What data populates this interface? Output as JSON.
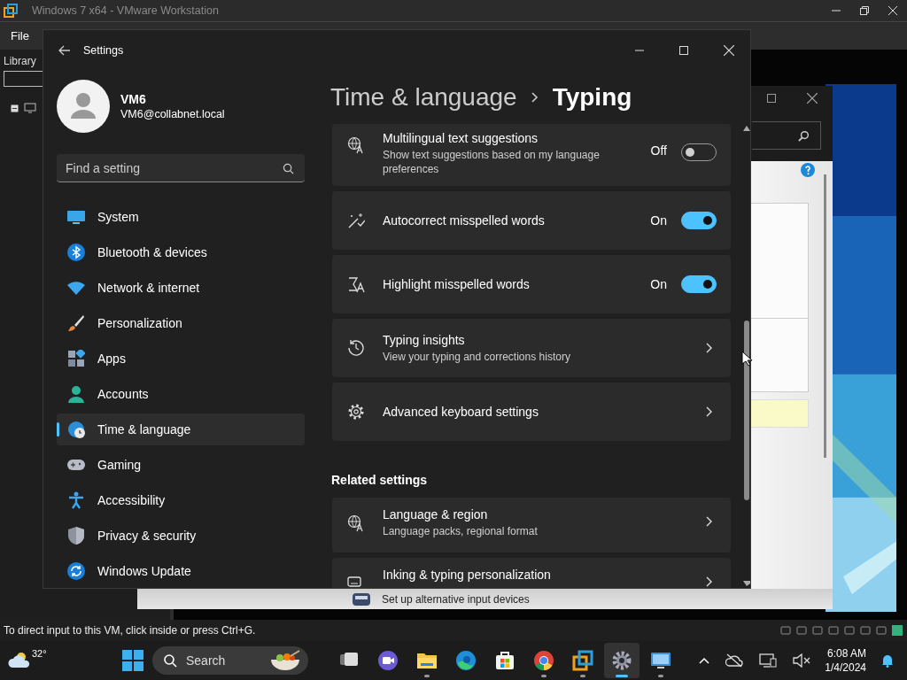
{
  "vmware": {
    "title": "Windows 7 x64 - VMware Workstation",
    "menu": [
      "File"
    ],
    "library_label": "Library",
    "status_text": "To direct input to this VM, click inside or press Ctrl+G."
  },
  "background_window": {
    "text": "Set up alternative input devices"
  },
  "settings": {
    "title": "Settings",
    "user": {
      "name": "VM6",
      "email": "VM6@collabnet.local"
    },
    "search": {
      "placeholder": "Find a setting"
    },
    "nav": [
      {
        "kind": "system",
        "label": "System",
        "selected": false
      },
      {
        "kind": "bluetooth",
        "label": "Bluetooth & devices",
        "selected": false
      },
      {
        "kind": "network",
        "label": "Network & internet",
        "selected": false
      },
      {
        "kind": "personalization",
        "label": "Personalization",
        "selected": false
      },
      {
        "kind": "apps",
        "label": "Apps",
        "selected": false
      },
      {
        "kind": "accounts",
        "label": "Accounts",
        "selected": false
      },
      {
        "kind": "time",
        "label": "Time & language",
        "selected": true
      },
      {
        "kind": "gaming",
        "label": "Gaming",
        "selected": false
      },
      {
        "kind": "accessibility",
        "label": "Accessibility",
        "selected": false
      },
      {
        "kind": "privacy",
        "label": "Privacy & security",
        "selected": false
      },
      {
        "kind": "update",
        "label": "Windows Update",
        "selected": false
      }
    ],
    "breadcrumb": [
      "Time & language",
      "Typing"
    ],
    "rows": [
      {
        "kind": "toggle",
        "title": "Multilingual text suggestions",
        "subtitle": "Show text suggestions based on my language preferences",
        "state_label": "Off",
        "on": false
      },
      {
        "kind": "toggle",
        "title": "Autocorrect misspelled words",
        "state_label": "On",
        "on": true
      },
      {
        "kind": "toggle",
        "title": "Highlight misspelled words",
        "state_label": "On",
        "on": true
      },
      {
        "kind": "link",
        "title": "Typing insights",
        "subtitle": "View your typing and corrections history"
      },
      {
        "kind": "link",
        "title": "Advanced keyboard settings"
      }
    ],
    "related_heading": "Related settings",
    "related": [
      {
        "kind": "link",
        "title": "Language & region",
        "subtitle": "Language packs, regional format"
      },
      {
        "kind": "link",
        "title": "Inking & typing personalization"
      }
    ]
  },
  "taskbar": {
    "weather": "32°",
    "search": "Search",
    "time": "6:08 AM",
    "date": "1/4/2024",
    "apps": [
      {
        "kind": "taskview",
        "running": false,
        "selected": false
      },
      {
        "kind": "meet",
        "running": false,
        "selected": false
      },
      {
        "kind": "explorer",
        "running": true,
        "selected": false
      },
      {
        "kind": "edge",
        "running": false,
        "selected": false
      },
      {
        "kind": "store",
        "running": false,
        "selected": false
      },
      {
        "kind": "chrome",
        "running": true,
        "selected": false
      },
      {
        "kind": "vmware",
        "running": true,
        "selected": false
      },
      {
        "kind": "settings",
        "running": true,
        "selected": true
      },
      {
        "kind": "remote",
        "running": true,
        "selected": false
      }
    ]
  }
}
